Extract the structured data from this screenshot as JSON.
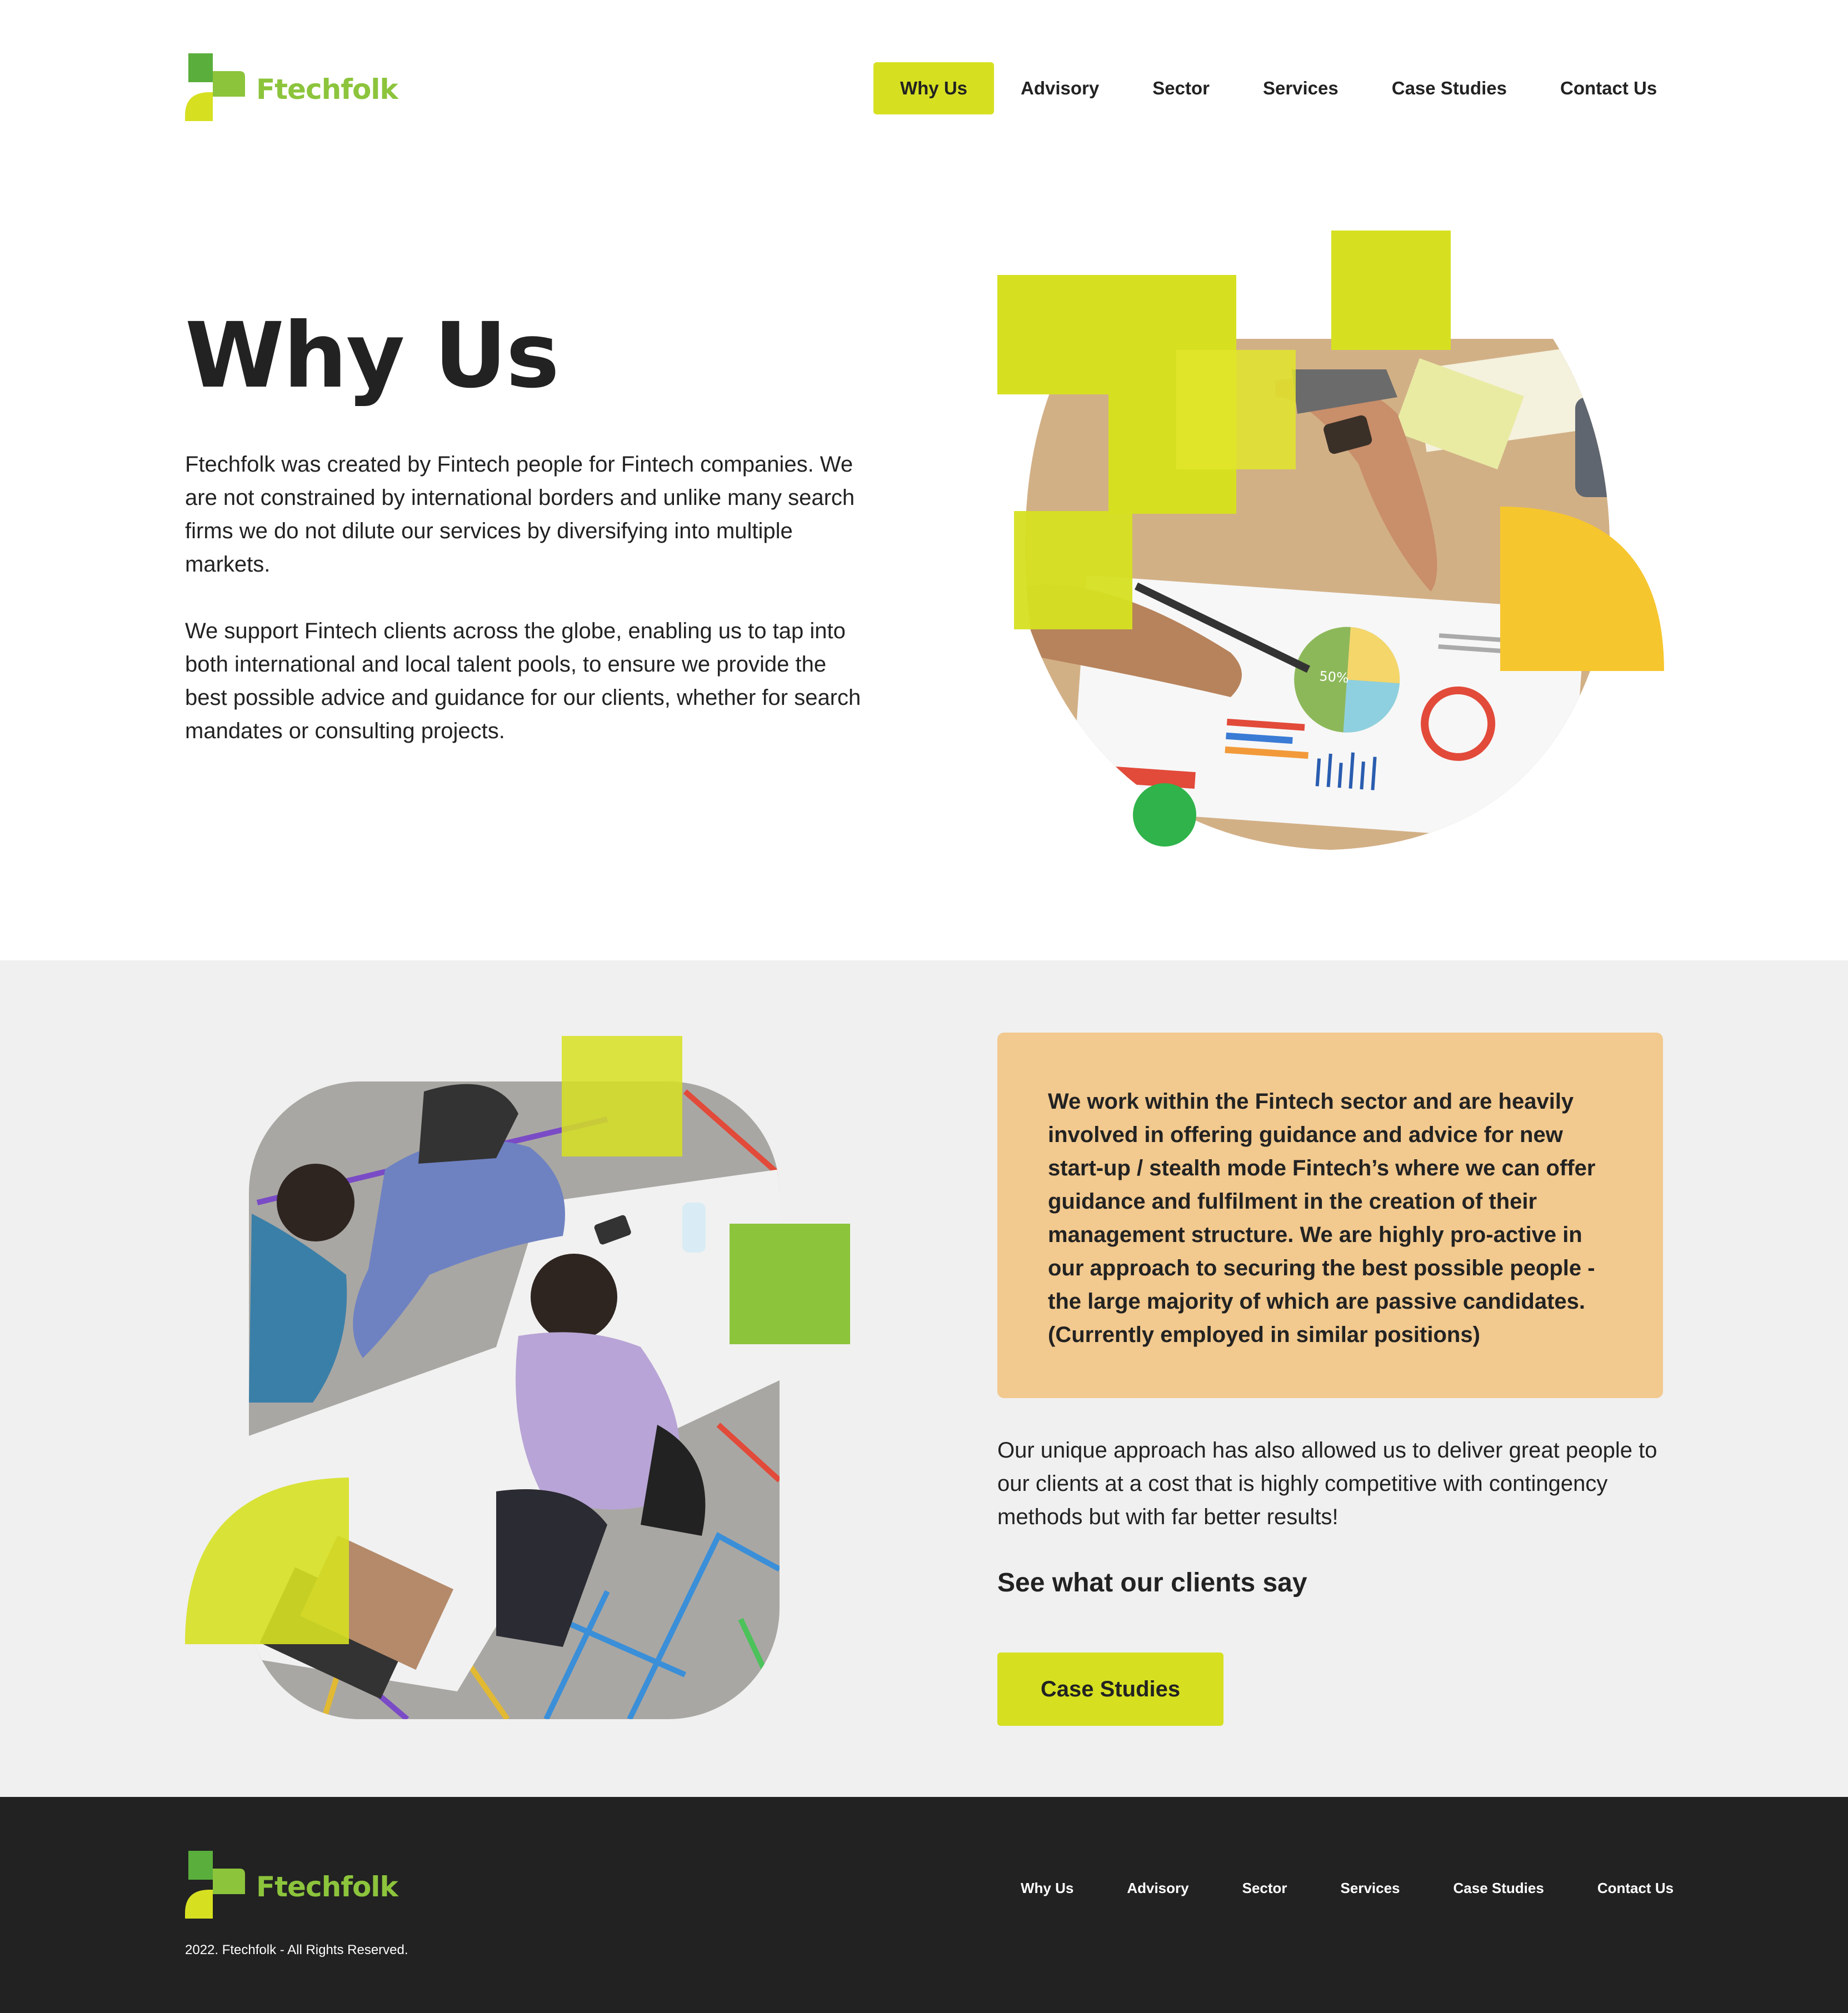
{
  "colors": {
    "accent": "#d6e021",
    "brand_green": "#8cc43c",
    "dot_green": "#2fb34a",
    "yellow": "#f6c62e",
    "quote_bg": "#f2c98e",
    "section_bg": "#f0f0f0",
    "footer_bg": "#222222"
  },
  "header": {
    "logo_text": "Ftechfolk",
    "nav": [
      {
        "label": "Why Us",
        "active": true
      },
      {
        "label": "Advisory"
      },
      {
        "label": "Sector"
      },
      {
        "label": "Services"
      },
      {
        "label": "Case Studies"
      },
      {
        "label": "Contact Us"
      }
    ]
  },
  "hero": {
    "title": "Why Us",
    "paragraph1": "Ftechfolk was created by Fintech people for Fintech companies. We are not constrained by international borders and unlike many search firms we do not dilute our services by diversifying into multiple markets.",
    "paragraph2": "We support Fintech clients across the globe, enabling us to tap into both international and local talent pools, to ensure we provide the best possible advice and guidance for our clients, whether for search mandates or consulting projects.",
    "chart_label": "50%"
  },
  "section2": {
    "quote": "We work within the Fintech sector and are heavily involved in offering guidance and advice for new start-up / stealth mode Fintech’s where we can offer guidance and fulfilment in the creation of their management structure. We are highly pro-active in our approach to securing the best possible people - the large majority of which are passive candidates. (Currently employed in similar positions)",
    "paragraph": "Our unique approach has also allowed us to deliver great people to our clients at a cost that is highly competitive with contingency methods but with far better results!",
    "subheading": "See what our clients say",
    "cta_label": "Case Studies"
  },
  "footer": {
    "logo_text": "Ftechfolk",
    "nav": [
      "Why Us",
      "Advisory",
      "Sector",
      "Services",
      "Case Studies",
      "Contact Us"
    ],
    "copyright": "2022. Ftechfolk - All Rights Reserved."
  }
}
